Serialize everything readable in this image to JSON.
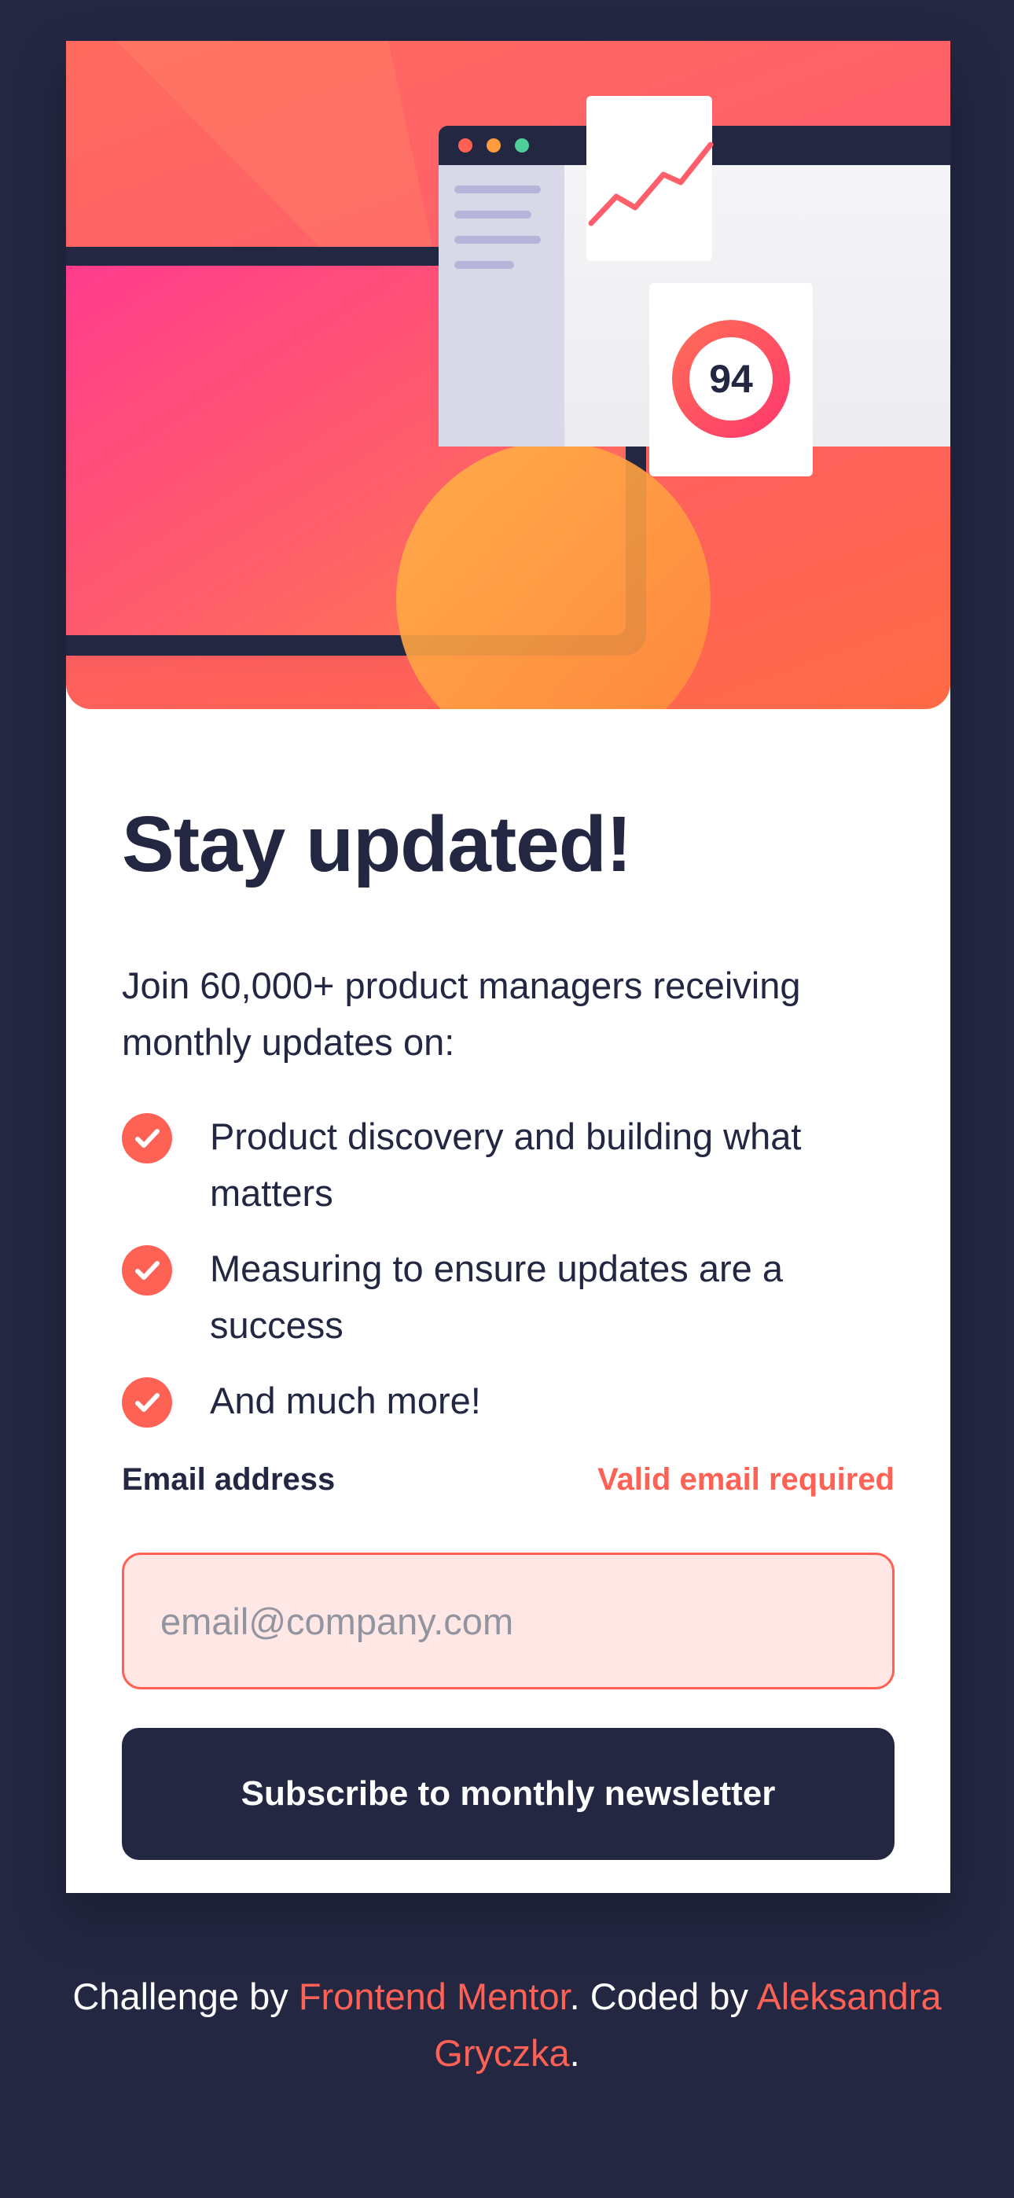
{
  "hero": {
    "score": "94",
    "colors": {
      "tomato": "#ff6155",
      "pink": "#ff3b8e",
      "orange": "#ff9c3f",
      "navy": "#242742"
    }
  },
  "signup": {
    "title": "Stay updated!",
    "intro": "Join 60,000+ product managers receiving monthly updates on:",
    "features": [
      {
        "icon": "check-icon",
        "text": "Product discovery and building what matters"
      },
      {
        "icon": "check-icon",
        "text": "Measuring to ensure updates are a success"
      },
      {
        "icon": "check-icon",
        "text": "And much more!"
      }
    ],
    "email_label": "Email address",
    "error_message": "Valid email required",
    "email_placeholder": "email@company.com",
    "email_value": "",
    "submit_label": "Subscribe to monthly newsletter"
  },
  "footer": {
    "prefix": "Challenge by ",
    "challenge_link": "Frontend Mentor",
    "middle": ". Coded by ",
    "author_link": "Aleksandra Gryczka",
    "suffix": "."
  }
}
